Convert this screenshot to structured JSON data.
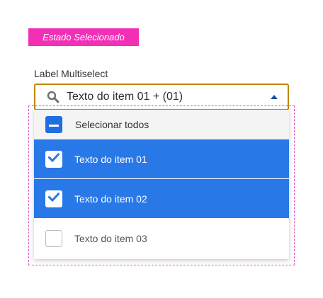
{
  "state_tag": "Estado Selecionado",
  "field": {
    "label": "Label Multiselect",
    "value": "Texto do item 01 + (01)"
  },
  "colors": {
    "tag_bg": "#f230b6",
    "focus_border": "#c1860a",
    "selected_bg": "#2878e8",
    "checkbox_blue": "#1f6fe0",
    "caret": "#1e4fa8"
  },
  "icons": {
    "search": "search-icon",
    "caret": "caret-up-icon",
    "check": "check-icon",
    "minus": "minus-icon"
  },
  "dropdown": {
    "select_all_label": "Selecionar todos",
    "select_all_state": "indeterminate",
    "options": [
      {
        "label": "Texto do item 01",
        "checked": true
      },
      {
        "label": "Texto do item 02",
        "checked": true
      },
      {
        "label": "Texto do item 03",
        "checked": false
      }
    ]
  }
}
